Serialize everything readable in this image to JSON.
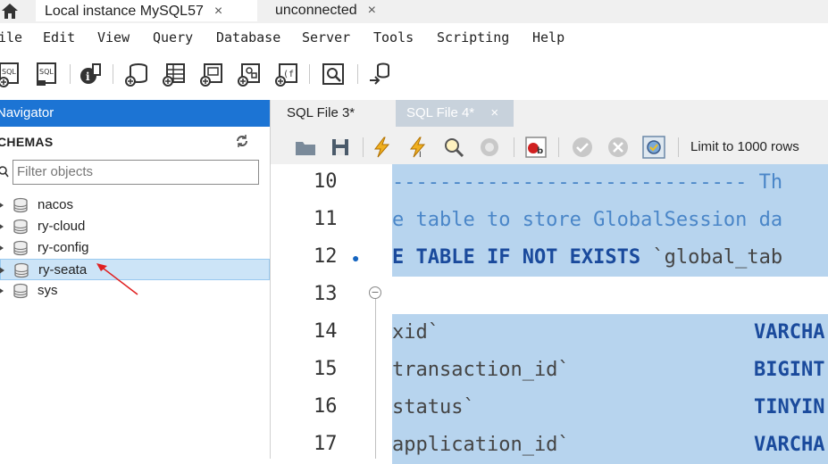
{
  "tabs": {
    "connection_tabs": [
      {
        "label": "Local instance MySQL57",
        "close": "×"
      },
      {
        "label": "unconnected",
        "close": "×"
      }
    ]
  },
  "menu": [
    "ile",
    "Edit",
    "View",
    "Query",
    "Database",
    "Server",
    "Tools",
    "Scripting",
    "Help"
  ],
  "toolbar_icons": [
    "new-sql-tab-icon",
    "open-sql-file-icon",
    "info-icon",
    "create-schema-icon",
    "create-table-icon",
    "create-view-icon",
    "create-procedure-icon",
    "create-function-icon",
    "search-table-data-icon",
    "reconnect-icon"
  ],
  "navigator": {
    "title": "Navigator",
    "schemas_title": "CHEMAS",
    "filter_placeholder": "Filter objects",
    "schemas": [
      {
        "name": "nacos",
        "selected": false
      },
      {
        "name": "ry-cloud",
        "selected": false
      },
      {
        "name": "ry-config",
        "selected": false
      },
      {
        "name": "ry-seata",
        "selected": true
      },
      {
        "name": "sys",
        "selected": false
      }
    ]
  },
  "editor": {
    "tabs": [
      {
        "label": "SQL File 3*",
        "active": false
      },
      {
        "label": "SQL File 4*",
        "active": true,
        "close": "×"
      }
    ],
    "limit_label": "Limit to 1000 rows",
    "lines": [
      {
        "num": "10",
        "text": "------------------------------ Th",
        "kind": "comment"
      },
      {
        "num": "11",
        "text": "e table to store GlobalSession da",
        "kind": "comment"
      },
      {
        "num": "12",
        "text": "E TABLE IF NOT EXISTS `global_tab",
        "kind": "create"
      },
      {
        "num": "13",
        "text": "",
        "kind": "blank"
      },
      {
        "num": "14",
        "text": "xid`",
        "type": "VARCHA",
        "kind": "column"
      },
      {
        "num": "15",
        "text": "transaction_id`",
        "type": "BIGINT",
        "kind": "column"
      },
      {
        "num": "16",
        "text": "status`",
        "type": "TINYIN",
        "kind": "column"
      },
      {
        "num": "17",
        "text": "application_id`",
        "type": "VARCHA",
        "kind": "column"
      }
    ]
  },
  "colors": {
    "navigator_header": "#1c74d4",
    "selection": "#b7d4ee",
    "keyword": "#1a4a9c",
    "annotation_arrow": "#e02020"
  }
}
